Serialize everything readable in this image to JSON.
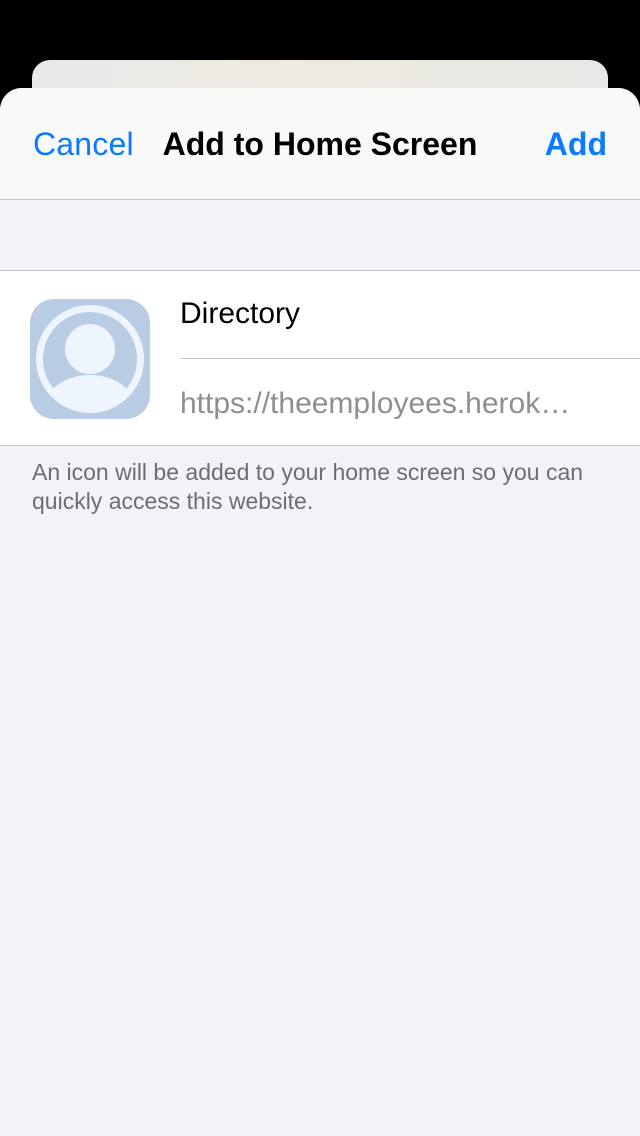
{
  "navbar": {
    "cancel_label": "Cancel",
    "title": "Add to Home Screen",
    "add_label": "Add"
  },
  "bookmark": {
    "name": "Directory",
    "url": "https://theemployees.herok…",
    "icon": "person-avatar-icon"
  },
  "footer_note": "An icon will be added to your home screen so you can quickly access this website.",
  "colors": {
    "accent": "#0a7aff",
    "background": "#f2f2f7",
    "icon_bg": "#b8cce4",
    "icon_fg": "#eef5ff"
  }
}
